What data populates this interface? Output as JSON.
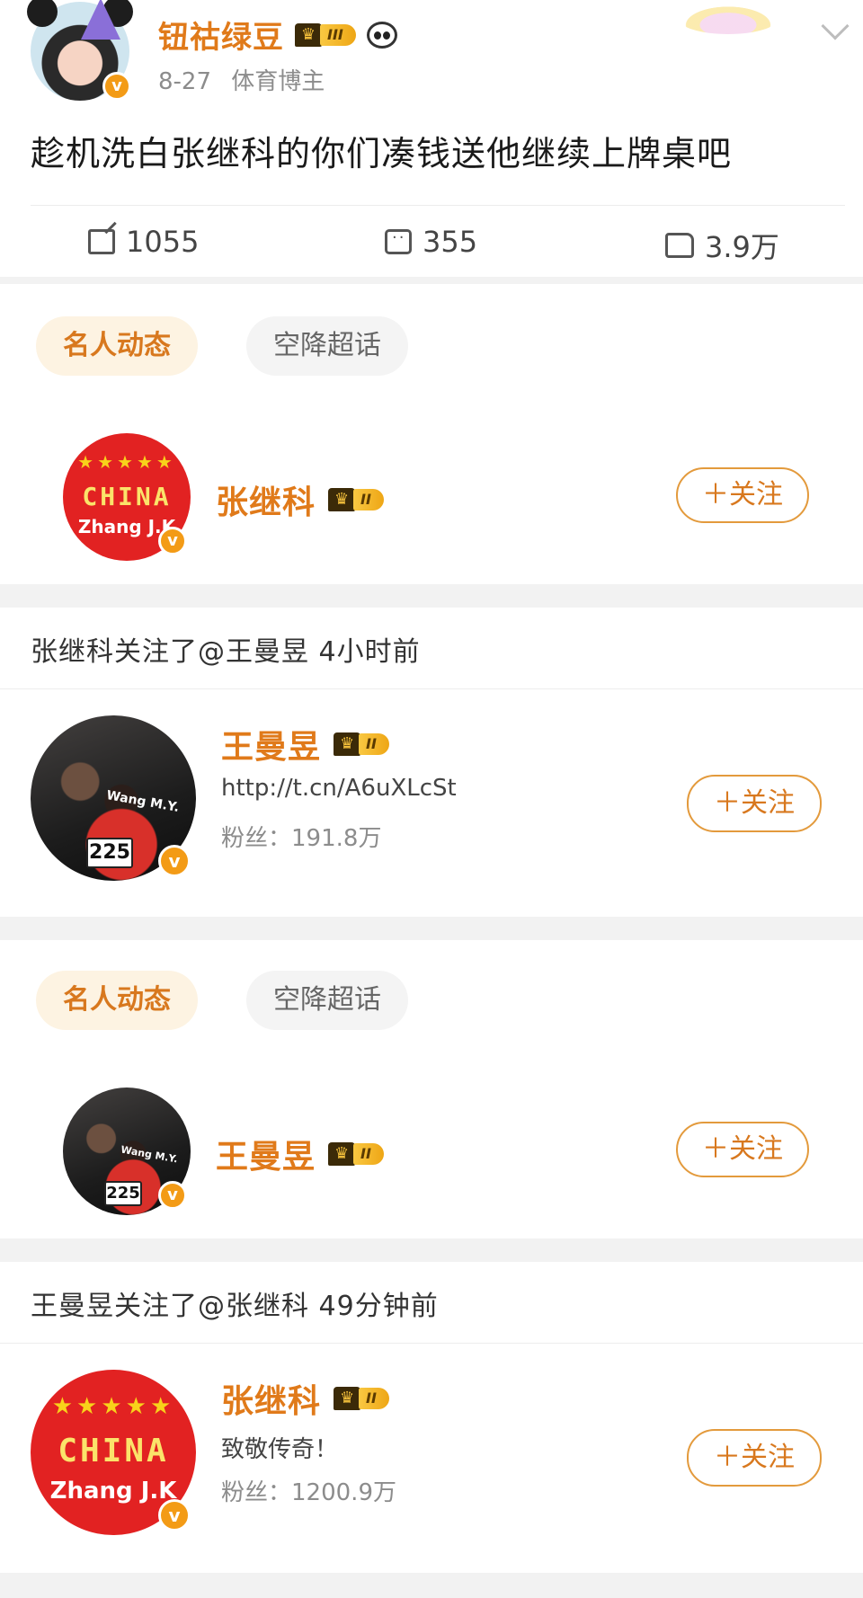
{
  "post": {
    "username": "钮祜绿豆",
    "level": "III",
    "date": "8-27",
    "tag": "体育博主",
    "text": "趁机洗白张继科的你们凑钱送他继续上牌桌吧",
    "actions": {
      "reposts": "1055",
      "comments": "355",
      "likes": "3.9万"
    }
  },
  "tabs": {
    "celebrity_label": "名人动态",
    "supertopic_label": "空降超话"
  },
  "card1": {
    "name": "张继科",
    "level": "II",
    "follow_label": "＋关注",
    "avatar_stars": "★★★★★",
    "avatar_country": "CHINA",
    "avatar_name": "Zhang J.K"
  },
  "activity1": {
    "title": "张继科关注了@王曼昱 4小时前",
    "name": "王曼昱",
    "level": "II",
    "link": "http://t.cn/A6uXLcSt",
    "fans_label": "粉丝：",
    "fans": "191.8万",
    "follow_label": "＋关注",
    "avatar_shirt": "Wang M.Y.",
    "avatar_bib": "225"
  },
  "card2": {
    "name": "王曼昱",
    "level": "II",
    "follow_label": "＋关注",
    "avatar_shirt": "Wang M.Y.",
    "avatar_bib": "225"
  },
  "activity2": {
    "title": "王曼昱关注了@张继科 49分钟前",
    "name": "张继科",
    "level": "II",
    "bio": "致敬传奇！",
    "fans_label": "粉丝：",
    "fans": "1200.9万",
    "follow_label": "＋关注",
    "avatar_stars": "★★★★★",
    "avatar_country": "CHINA",
    "avatar_name": "Zhang J.K"
  },
  "colors": {
    "accent": "#e07a1a",
    "verified": "#f39b16",
    "china_red": "#e22222"
  }
}
